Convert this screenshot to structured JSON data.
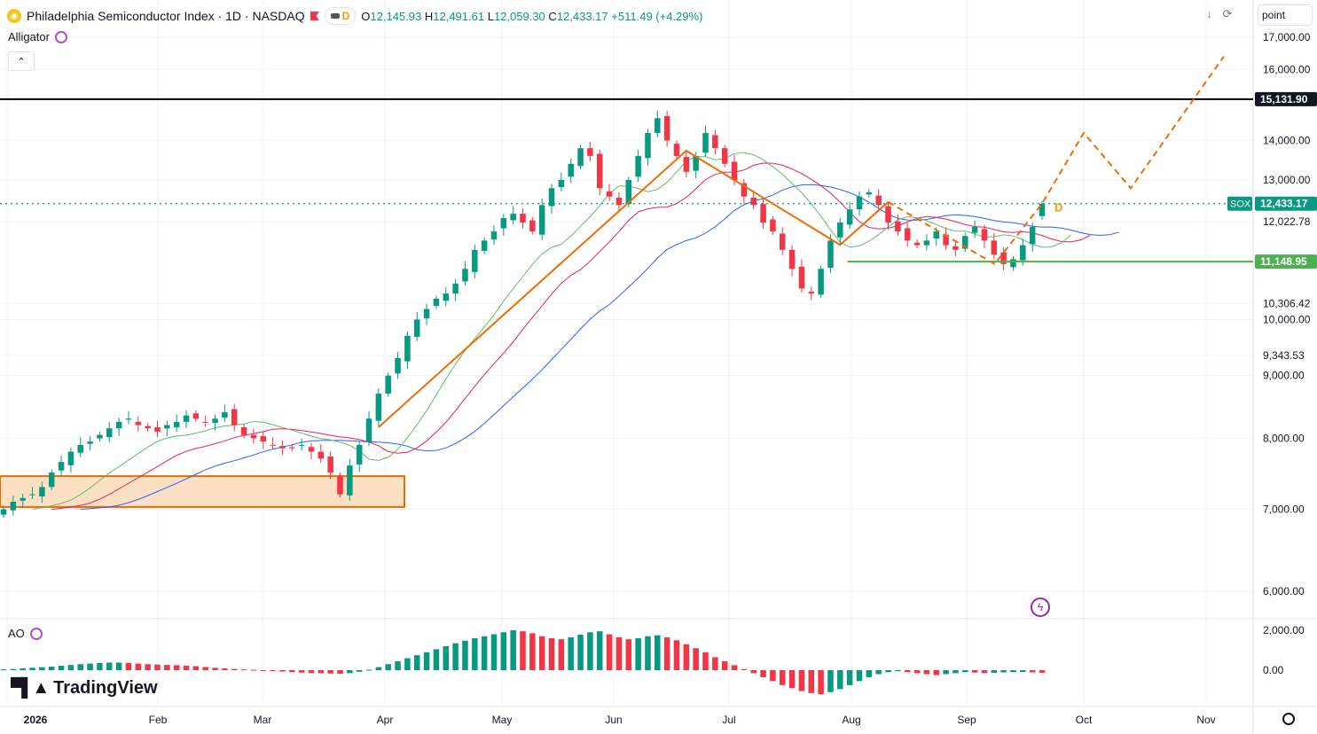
{
  "header": {
    "title": "Philadelphia Semiconductor Index · 1D · NASDAQ",
    "badge_letter": "D",
    "o_label": "O",
    "o_value": "12,145.93",
    "h_label": "H",
    "h_value": "12,491.61",
    "l_label": "L",
    "l_value": "12,059.30",
    "c_label": "C",
    "c_value": "12,433.17",
    "change": "+511.49 (+4.29%)",
    "indicator_main": "Alligator",
    "indicator_sub": "AO",
    "unit": "point"
  },
  "brand": {
    "logo_text": "TradingView"
  },
  "colors": {
    "up": "#089981",
    "down": "#f23645",
    "drawing": "#ef6c00",
    "jaw": "#2962ff",
    "teeth": "#e91e63",
    "lips": "#66bb6a",
    "support": "#4caf50",
    "resistance": "#000000",
    "zone_fill": "#fce0c4"
  },
  "icons": [
    "logo-icon",
    "flag-icon",
    "cycle-icon",
    "collapse-chevron-icon",
    "download-icon",
    "fullscreen-icon",
    "settings-gear-icon",
    "lightning-icon"
  ],
  "chart_data": {
    "type": "candlestick",
    "y_scale": "log",
    "y_ticks": [
      "17,000.00",
      "16,000.00",
      "14,000.00",
      "13,000.00",
      "12,022.78",
      "10,306.42",
      "10,000.00",
      "9,343.53",
      "9,000.00",
      "8,000.00",
      "7,000.00",
      "6,000.00"
    ],
    "x_ticks": [
      "2026",
      "Feb",
      "Mar",
      "Apr",
      "May",
      "Jun",
      "Jul",
      "Aug",
      "Sep",
      "Oct",
      "Nov"
    ],
    "ohlc_last": {
      "open": 12145.93,
      "high": 12491.61,
      "low": 12059.3,
      "close": 12433.17
    },
    "price_labels": [
      {
        "text": "15,131.90",
        "value": 15131.9,
        "style": "resistance"
      },
      {
        "text": "12,433.17",
        "value": 12433.17,
        "style": "last",
        "symbol": "SOX"
      },
      {
        "text": "11,148.95",
        "value": 11148.95,
        "style": "support"
      }
    ],
    "closes_approx": [
      7000,
      7100,
      7150,
      7200,
      7300,
      7500,
      7650,
      7800,
      7900,
      7950,
      8050,
      8150,
      8250,
      8300,
      8200,
      8150,
      8100,
      8200,
      8250,
      8350,
      8300,
      8250,
      8300,
      8400,
      8200,
      8050,
      8000,
      7950,
      7900,
      7850,
      7850,
      7900,
      7800,
      7700,
      7500,
      7200,
      7600,
      7900,
      8300,
      8700,
      9000,
      9300,
      9700,
      10000,
      10200,
      10400,
      10500,
      10700,
      11000,
      11400,
      11600,
      11800,
      12100,
      12200,
      12000,
      11800,
      12400,
      12800,
      13000,
      13400,
      13800,
      13600,
      12800,
      12600,
      12400,
      13000,
      13600,
      14200,
      14600,
      14000,
      13600,
      13200,
      13600,
      14200,
      13800,
      13400,
      13000,
      12600,
      12400,
      12000,
      11800,
      11400,
      11000,
      10600,
      10500,
      11000,
      11600,
      12000,
      12300,
      12600,
      12700,
      12400,
      12000,
      11800,
      11600,
      11500,
      11600,
      11800,
      11500,
      11400,
      11700,
      11900,
      11600,
      11300,
      11100,
      11200,
      11500,
      11900,
      12433
    ],
    "alligator": {
      "jaw": "blue",
      "teeth": "red",
      "lips": "green"
    },
    "ao": {
      "y_ticks": [
        "2,000.00",
        "0.00"
      ],
      "values": [
        40,
        60,
        90,
        120,
        150,
        180,
        220,
        260,
        300,
        330,
        360,
        380,
        380,
        360,
        330,
        300,
        280,
        260,
        250,
        230,
        200,
        160,
        120,
        90,
        60,
        40,
        20,
        -10,
        -40,
        -70,
        -100,
        -120,
        -140,
        -150,
        -170,
        -180,
        -150,
        -80,
        20,
        150,
        300,
        450,
        600,
        750,
        900,
        1050,
        1200,
        1350,
        1480,
        1600,
        1700,
        1800,
        1900,
        2000,
        1950,
        1850,
        1700,
        1600,
        1550,
        1650,
        1780,
        1900,
        1950,
        1800,
        1650,
        1550,
        1600,
        1700,
        1750,
        1650,
        1500,
        1300,
        1100,
        900,
        650,
        450,
        250,
        50,
        -150,
        -350,
        -550,
        -750,
        -900,
        -1050,
        -1150,
        -1200,
        -1100,
        -950,
        -750,
        -550,
        -350,
        -200,
        -100,
        -50,
        -100,
        -150,
        -200,
        -250,
        -200,
        -150,
        -100,
        -120,
        -150,
        -130,
        -110,
        -100,
        -90,
        -110,
        -130
      ]
    },
    "annotations": {
      "solid_zigzag_dates": [
        "2026-03-31",
        "2026-06-19",
        "2026-07-29",
        "2026-08-12"
      ],
      "projection_letter": "D"
    }
  }
}
